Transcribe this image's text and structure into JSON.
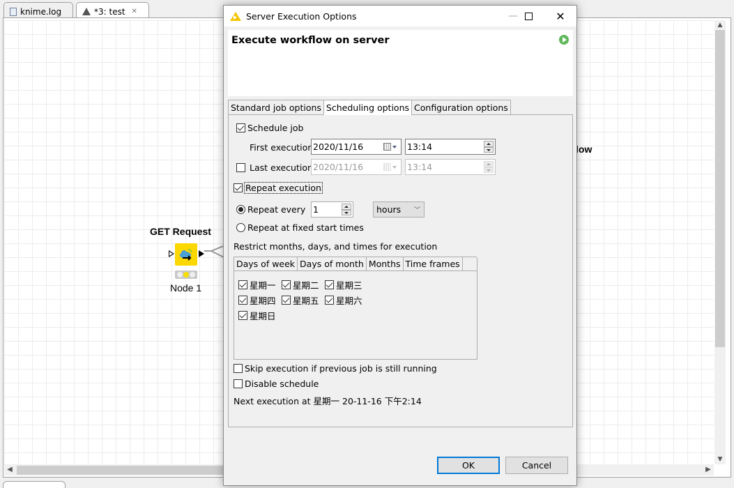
{
  "editor": {
    "tabs": [
      {
        "label": "knime.log",
        "icon": "document-icon",
        "active": false
      },
      {
        "label": "*3: test",
        "icon": "knime-workflow-icon",
        "active": true,
        "close": "✕"
      }
    ],
    "node": {
      "title": "GET Request",
      "label": "Node 1",
      "status": "configured",
      "color": "#fcd700"
    },
    "partial_text": "low"
  },
  "dialog": {
    "title": "Server Execution Options",
    "header_title": "Execute workflow on server",
    "tabs": [
      {
        "label": "Standard job options",
        "active": false
      },
      {
        "label": "Scheduling options",
        "active": true
      },
      {
        "label": "Configuration options",
        "active": false
      }
    ],
    "scheduling": {
      "schedule_job": {
        "label": "Schedule job",
        "checked": true
      },
      "first_execution": {
        "label": "First execution",
        "date": "2020/11/16",
        "time": "13:14"
      },
      "last_execution": {
        "label": "Last execution",
        "checked": false,
        "date": "2020/11/16",
        "time": "13:14",
        "enabled": false
      },
      "repeat_execution": {
        "label": "Repeat execution",
        "checked": true
      },
      "repeat_every": {
        "label": "Repeat every",
        "selected": true,
        "value": "1",
        "unit": "hours"
      },
      "repeat_fixed": {
        "label": "Repeat at fixed start times",
        "selected": false
      },
      "restrict_label": "Restrict months, days, and times for execution",
      "restrict_tabs": [
        {
          "label": "Days of week",
          "active": true
        },
        {
          "label": "Days of month",
          "active": false
        },
        {
          "label": "Months",
          "active": false
        },
        {
          "label": "Time frames",
          "active": false
        }
      ],
      "days": [
        {
          "label": "星期一",
          "checked": true
        },
        {
          "label": "星期二",
          "checked": true
        },
        {
          "label": "星期三",
          "checked": true
        },
        {
          "label": "星期四",
          "checked": true
        },
        {
          "label": "星期五",
          "checked": true
        },
        {
          "label": "星期六",
          "checked": true
        },
        {
          "label": "星期日",
          "checked": true
        }
      ],
      "skip_execution": {
        "label": "Skip execution if previous job is still running",
        "checked": false
      },
      "disable_schedule": {
        "label": "Disable schedule",
        "checked": false
      },
      "next_execution": "Next execution at 星期一 20-11-16 下午2:14"
    },
    "buttons": {
      "ok": "OK",
      "cancel": "Cancel"
    }
  },
  "colors": {
    "accent": "#0078d7",
    "knime_yellow": "#fcd700",
    "run_green": "#5fb85a"
  }
}
